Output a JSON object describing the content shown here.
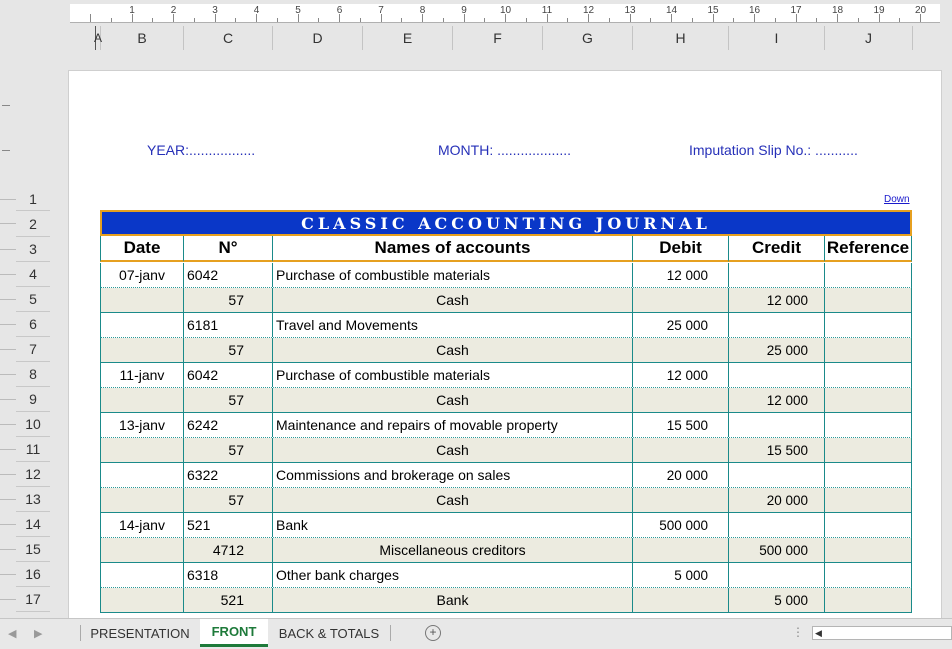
{
  "ruler": {
    "numbers": [
      "1",
      "2",
      "3",
      "4",
      "5",
      "6",
      "7",
      "8",
      "9",
      "10",
      "11",
      "12",
      "13",
      "14",
      "15",
      "16",
      "17",
      "18",
      "19",
      "20"
    ]
  },
  "columns": [
    "A",
    "B",
    "C",
    "D",
    "E",
    "F",
    "G",
    "H",
    "I",
    "J"
  ],
  "header_fields": {
    "year": "YEAR:.................",
    "month": "MONTH: ...................",
    "slip": "Imputation Slip No.: ..........."
  },
  "down_link": "Down",
  "row_numbers": [
    "1",
    "2",
    "3",
    "4",
    "5",
    "6",
    "7",
    "8",
    "9",
    "10",
    "11",
    "12",
    "13",
    "14",
    "15",
    "16",
    "17"
  ],
  "journal": {
    "title": "CLASSIC ACCOUNTING JOURNAL",
    "headers": {
      "date": "Date",
      "no": "N°",
      "name": "Names of accounts",
      "debit": "Debit",
      "credit": "Credit",
      "reference": "Reference"
    },
    "rows": [
      {
        "date": "07-janv",
        "no": "6042",
        "name": "Purchase of combustible materials",
        "debit": "12 000",
        "credit": "",
        "type": "debit"
      },
      {
        "date": "",
        "no": "57",
        "name": "Cash",
        "debit": "",
        "credit": "12 000",
        "type": "credit"
      },
      {
        "date": "",
        "no": "6181",
        "name": "Travel and Movements",
        "debit": "25 000",
        "credit": "",
        "type": "debit"
      },
      {
        "date": "",
        "no": "57",
        "name": "Cash",
        "debit": "",
        "credit": "25 000",
        "type": "credit"
      },
      {
        "date": "11-janv",
        "no": "6042",
        "name": "Purchase of combustible materials",
        "debit": "12 000",
        "credit": "",
        "type": "debit"
      },
      {
        "date": "",
        "no": "57",
        "name": "Cash",
        "debit": "",
        "credit": "12 000",
        "type": "credit"
      },
      {
        "date": "13-janv",
        "no": "6242",
        "name": "Maintenance and repairs of movable property",
        "debit": "15 500",
        "credit": "",
        "type": "debit"
      },
      {
        "date": "",
        "no": "57",
        "name": "Cash",
        "debit": "",
        "credit": "15 500",
        "type": "credit"
      },
      {
        "date": "",
        "no": "6322",
        "name": "Commissions and brokerage on sales",
        "debit": "20 000",
        "credit": "",
        "type": "debit"
      },
      {
        "date": "",
        "no": "57",
        "name": "Cash",
        "debit": "",
        "credit": "20 000",
        "type": "credit"
      },
      {
        "date": "14-janv",
        "no": "521",
        "name": "Bank",
        "debit": "500 000",
        "credit": "",
        "type": "debit"
      },
      {
        "date": "",
        "no": "4712",
        "name": "Miscellaneous creditors",
        "debit": "",
        "credit": "500 000",
        "type": "credit"
      },
      {
        "date": "",
        "no": "6318",
        "name": "Other bank charges",
        "debit": "5 000",
        "credit": "",
        "type": "debit"
      },
      {
        "date": "",
        "no": "521",
        "name": "Bank",
        "debit": "",
        "credit": "5 000",
        "type": "credit"
      }
    ]
  },
  "sheet_tabs": [
    {
      "label": "PRESENTATION",
      "active": false
    },
    {
      "label": "FRONT",
      "active": true
    },
    {
      "label": "BACK & TOTALS",
      "active": false
    }
  ],
  "add_sheet_symbol": "+",
  "colors": {
    "title_bg": "#0a37c8",
    "accent_border": "#e6a020",
    "grid_teal": "#1a8a8a",
    "header_text": "#2630b8",
    "active_tab": "#1e7a3a"
  }
}
